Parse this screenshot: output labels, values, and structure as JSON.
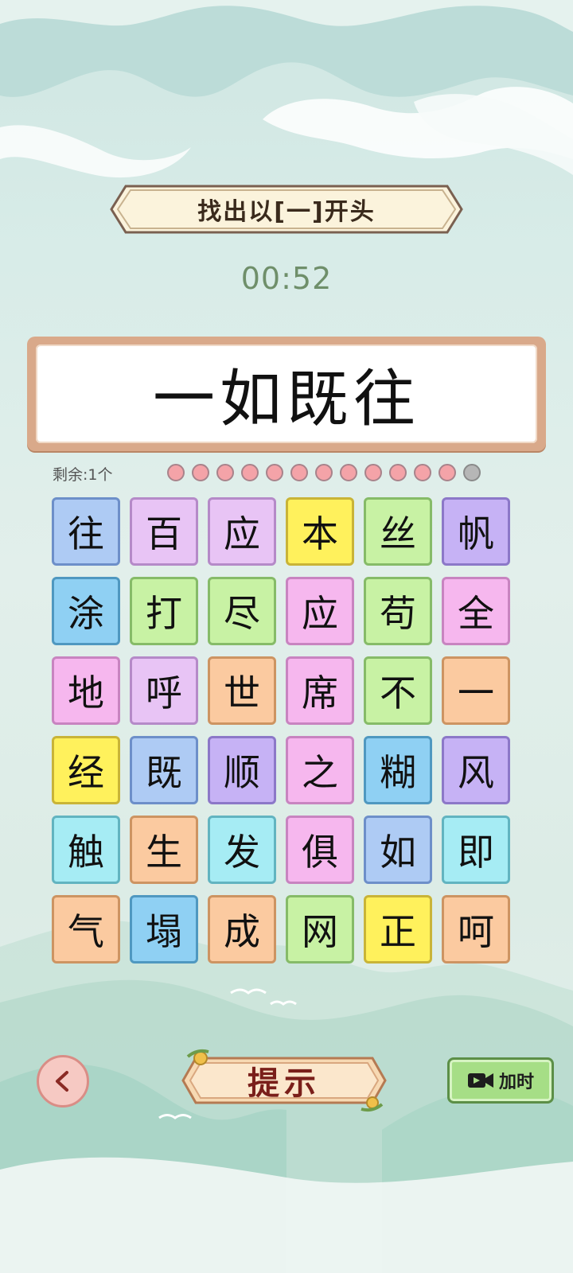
{
  "title": "找出以[一]开头",
  "timer": "00:52",
  "answer": "一如既往",
  "remaining_label": "剩余:1个",
  "progress": {
    "done": 12,
    "total": 13
  },
  "tiles": [
    {
      "char": "往",
      "color": "blue"
    },
    {
      "char": "百",
      "color": "lav"
    },
    {
      "char": "应",
      "color": "lav"
    },
    {
      "char": "本",
      "color": "yel"
    },
    {
      "char": "丝",
      "color": "green"
    },
    {
      "char": "帆",
      "color": "purp"
    },
    {
      "char": "涂",
      "color": "sky"
    },
    {
      "char": "打",
      "color": "green"
    },
    {
      "char": "尽",
      "color": "green"
    },
    {
      "char": "应",
      "color": "pink"
    },
    {
      "char": "苟",
      "color": "green"
    },
    {
      "char": "全",
      "color": "pink"
    },
    {
      "char": "地",
      "color": "pink"
    },
    {
      "char": "呼",
      "color": "lav"
    },
    {
      "char": "世",
      "color": "orng"
    },
    {
      "char": "席",
      "color": "pink"
    },
    {
      "char": "不",
      "color": "green"
    },
    {
      "char": "一",
      "color": "orng"
    },
    {
      "char": "经",
      "color": "yel"
    },
    {
      "char": "既",
      "color": "blue"
    },
    {
      "char": "顺",
      "color": "purp"
    },
    {
      "char": "之",
      "color": "pink"
    },
    {
      "char": "糊",
      "color": "sky"
    },
    {
      "char": "风",
      "color": "purp"
    },
    {
      "char": "触",
      "color": "cyan"
    },
    {
      "char": "生",
      "color": "orng"
    },
    {
      "char": "发",
      "color": "cyan"
    },
    {
      "char": "俱",
      "color": "pink"
    },
    {
      "char": "如",
      "color": "blue"
    },
    {
      "char": "即",
      "color": "cyan"
    },
    {
      "char": "气",
      "color": "orng"
    },
    {
      "char": "塌",
      "color": "sky"
    },
    {
      "char": "成",
      "color": "orng"
    },
    {
      "char": "网",
      "color": "green"
    },
    {
      "char": "正",
      "color": "yel"
    },
    {
      "char": "呵",
      "color": "orng"
    }
  ],
  "buttons": {
    "back_icon": "chevron-left-icon",
    "hint_label": "提示",
    "add_time_icon": "video-camera-icon",
    "add_time_label": "加时"
  },
  "colors": {
    "accent_timer": "#6f8f6a",
    "frame": "#d9a98a",
    "hint_text": "#7a1f1a",
    "add_time_bg": "#a6de86"
  }
}
